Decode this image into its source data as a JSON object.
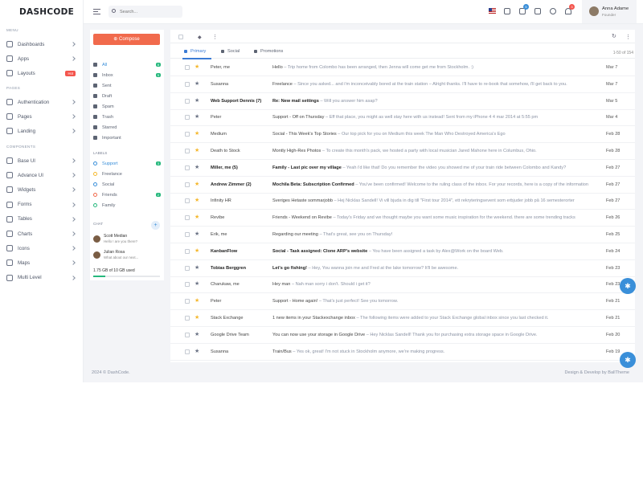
{
  "brand": "DASHCODE",
  "sidebar": {
    "menu_title": "MENU",
    "pages_title": "PAGES",
    "components_title": "COMPONENTS",
    "menu_items": [
      {
        "label": "Dashboards",
        "icon": "home-icon"
      },
      {
        "label": "Apps",
        "icon": "grid-icon"
      },
      {
        "label": "Layouts",
        "icon": "layout-icon",
        "badge": "Hot"
      }
    ],
    "page_items": [
      {
        "label": "Authentication",
        "icon": "user-icon"
      },
      {
        "label": "Pages",
        "icon": "command-icon"
      },
      {
        "label": "Landing",
        "icon": "bell-icon"
      }
    ],
    "component_items": [
      {
        "label": "Base UI",
        "icon": "box-icon"
      },
      {
        "label": "Advance UI",
        "icon": "layers-icon"
      },
      {
        "label": "Widgets",
        "icon": "copy-icon"
      },
      {
        "label": "Forms",
        "icon": "clipboard-icon"
      },
      {
        "label": "Tables",
        "icon": "table-icon"
      },
      {
        "label": "Charts",
        "icon": "pie-chart-icon"
      },
      {
        "label": "Icons",
        "icon": "star-icon"
      },
      {
        "label": "Maps",
        "icon": "map-icon"
      },
      {
        "label": "Multi Level",
        "icon": "share-icon"
      }
    ]
  },
  "topbar": {
    "search_placeholder": "Search...",
    "cart_badge": "5",
    "notif_badge": "3",
    "user_name": "Anna Adame",
    "user_role": "Founder"
  },
  "mail_left": {
    "compose": "Compose",
    "folders": [
      {
        "label": "All",
        "count": "8",
        "color": "#26b87d"
      },
      {
        "label": "Inbox",
        "count": "5",
        "color": "#26b87d"
      },
      {
        "label": "Sent",
        "count": ""
      },
      {
        "label": "Draft",
        "count": ""
      },
      {
        "label": "Spam",
        "count": ""
      },
      {
        "label": "Trash",
        "count": ""
      },
      {
        "label": "Starred",
        "count": ""
      },
      {
        "label": "Important",
        "count": ""
      }
    ],
    "labels_title": "LABELS",
    "labels": [
      {
        "label": "Support",
        "count": "3",
        "color": "#3a8fd9"
      },
      {
        "label": "Freelance",
        "count": "",
        "color": "#f5b82e"
      },
      {
        "label": "Social",
        "count": "",
        "color": "#3a8fd9"
      },
      {
        "label": "Friends",
        "count": "2",
        "color": "#f16a4c"
      },
      {
        "label": "Family",
        "count": "",
        "color": "#26b87d"
      }
    ],
    "chat_title": "CHAT",
    "chats": [
      {
        "name": "Scott Median",
        "msg": "Hello ! are you there?"
      },
      {
        "name": "Julian Rosa",
        "msg": "What about our next..."
      }
    ],
    "storage": "1.75 GB of 10 GB used",
    "storage_pct": 0.175
  },
  "mail_main": {
    "tabs": [
      "Primary",
      "Social",
      "Promotions"
    ],
    "pager": "1-50 of 154",
    "rows": [
      {
        "from": "Peter, me",
        "subject": "Hello",
        "preview": " – Trip home from Colombo has been arranged, then Jenna will come get me from Stockholm. :)",
        "date": "Mar 7",
        "starred": true,
        "unread": false
      },
      {
        "from": "Susanna",
        "subject": "Freelance",
        "preview": " – Since you asked... and i'm inconceivably bored at the train station – Alright thanks. I'll have to re-book that somehow, i'll get back to you.",
        "date": "Mar 7",
        "starred": false,
        "unread": false
      },
      {
        "from": "Web Support Dennis (7)",
        "subject": "Re: New mail settings",
        "preview": " – Will you answer him asap?",
        "date": "Mar 5",
        "starred": false,
        "unread": true
      },
      {
        "from": "Peter",
        "subject": "Support - Off on Thursday",
        "preview": " – Eff that place, you might as well stay here with us instead! Sent from my iPhone 4 4 mar 2014 at 5:55 pm",
        "date": "Mar 4",
        "starred": false,
        "unread": false
      },
      {
        "from": "Medium",
        "subject": "Social - This Week's Top Stories",
        "preview": " – Our top pick for you on Medium this week The Man Who Destroyed America's Ego",
        "date": "Feb 28",
        "starred": true,
        "unread": false
      },
      {
        "from": "Death to Stock",
        "subject": "Montly High-Res Photos",
        "preview": " – To create this month's pack, we hosted a party with local musician Jared Mahone here in Columbus, Ohio.",
        "date": "Feb 28",
        "starred": true,
        "unread": false
      },
      {
        "from": "Miller, me (5)",
        "subject": "Family - Last pic over my village",
        "preview": " – Yeah i'd like that! Do you remember the video you showed me of your train ride between Colombo and Kandy?",
        "date": "Feb 27",
        "starred": false,
        "unread": true
      },
      {
        "from": "Andrew Zimmer (2)",
        "subject": "Mochila Beta: Subscription Confirmed",
        "preview": " – You've been confirmed! Welcome to the ruling class of the inbox. For your records, here is a copy of the information",
        "date": "Feb 27",
        "starred": true,
        "unread": true
      },
      {
        "from": "Infinity HR",
        "subject": "Sveriges Hetaste sommarjobb",
        "preview": " – Hej Nicklas Sandell! Vi vill bjuda in dig till \"First tour 2014\", ett rekryteringsevent som erbjuder jobb på 16 semesterorter",
        "date": "Feb 27",
        "starred": true,
        "unread": false
      },
      {
        "from": "Revibe",
        "subject": "Friends - Weekend on Revibe",
        "preview": " – Today's Friday and we thought maybe you want some music inspiration for the weekend. there are some trending tracks",
        "date": "Feb 26",
        "starred": true,
        "unread": false
      },
      {
        "from": "Erik, me",
        "subject": "Regarding our meeting",
        "preview": " – That's great, see you on Thursday!",
        "date": "Feb 25",
        "starred": false,
        "unread": false
      },
      {
        "from": "KanbanFlow",
        "subject": "Social - Task assigned: Clone ARP's website",
        "preview": " – You have been assigned a task by Alex@Work on the board Web.",
        "date": "Feb 24",
        "starred": true,
        "unread": true
      },
      {
        "from": "Tobias Berggren",
        "subject": "Let's go fishing!",
        "preview": " – Hey, You wanna join me and Fred at the lake tomorrow? It'll be awesome.",
        "date": "Feb 23",
        "starred": false,
        "unread": true
      },
      {
        "from": "Charukaw, me",
        "subject": "Hey man",
        "preview": " – Nah man sorry i don't. Should i get it?",
        "date": "Feb 23",
        "starred": false,
        "unread": false
      },
      {
        "from": "Peter",
        "subject": "Support - Home again!",
        "preview": " – That's just perfect! See you tomorrow.",
        "date": "Feb 21",
        "starred": true,
        "unread": false
      },
      {
        "from": "Stack Exchange",
        "subject": "1 new items in your Stackexchange inbox",
        "preview": " – The following items were added to your Stack Exchange global inbox since you last checked it.",
        "date": "Feb 21",
        "starred": true,
        "unread": false
      },
      {
        "from": "Google Drive Team",
        "subject": "You can now use your storage in Google Drive",
        "preview": " – Hey Nicklas Sandell! Thank you for purchasing extra storage space in Google Drive.",
        "date": "Feb 20",
        "starred": false,
        "unread": false
      },
      {
        "from": "Susanna",
        "subject": "Train/Bus",
        "preview": " – Yes ok, great! I'm not stuck in Stockholm anymore, we're making progress.",
        "date": "Feb 19",
        "starred": false,
        "unread": false
      }
    ]
  },
  "footer": {
    "left": "2024 © DashCode.",
    "right": "Design & Develop by BallTheme"
  }
}
